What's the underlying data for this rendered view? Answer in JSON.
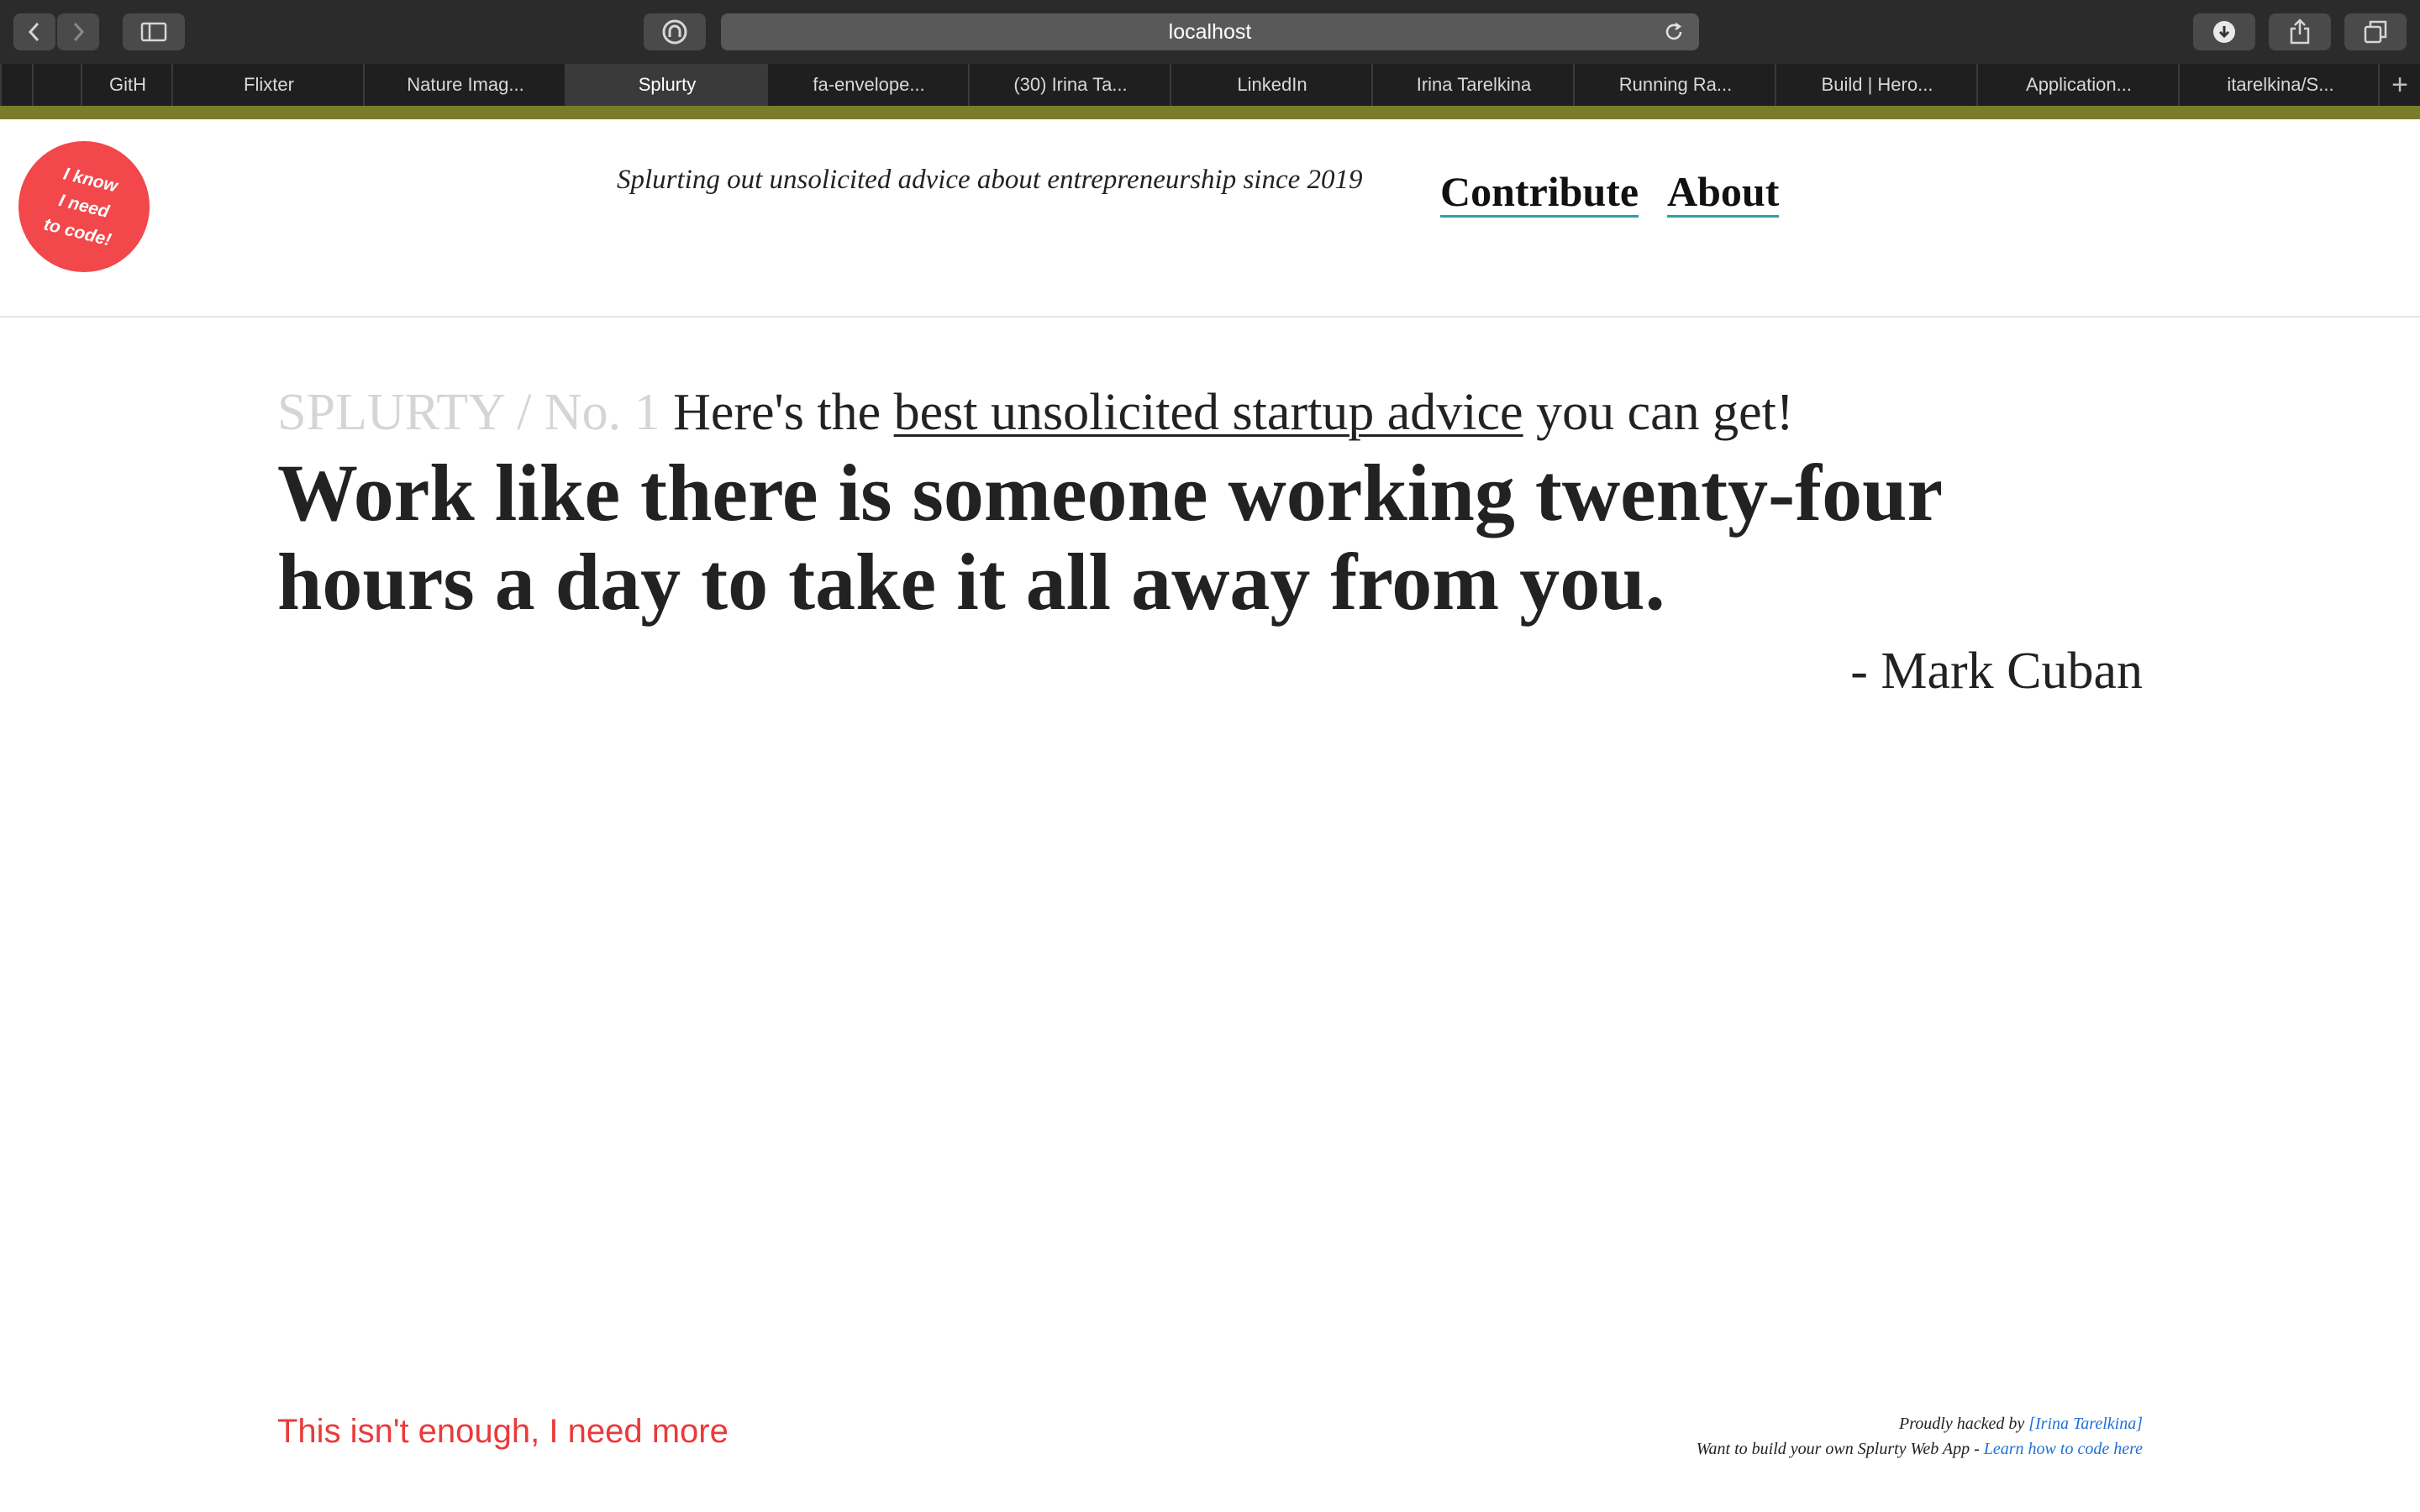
{
  "browser": {
    "url": "localhost",
    "tabs": [
      {
        "label": "",
        "active": false
      },
      {
        "label": "",
        "active": false
      },
      {
        "label": "GitH",
        "active": false
      },
      {
        "label": "Flixter",
        "active": false
      },
      {
        "label": "Nature Imag...",
        "active": false
      },
      {
        "label": "Splurty",
        "active": true
      },
      {
        "label": "fa-envelope...",
        "active": false
      },
      {
        "label": "(30) Irina Ta...",
        "active": false
      },
      {
        "label": "LinkedIn",
        "active": false
      },
      {
        "label": "Irina Tarelkina",
        "active": false
      },
      {
        "label": "Running Ra...",
        "active": false
      },
      {
        "label": "Build | Hero...",
        "active": false
      },
      {
        "label": "Application...",
        "active": false
      },
      {
        "label": "itarelkina/S...",
        "active": false
      }
    ],
    "new_tab": "+",
    "colors": {
      "chrome": "#2b2b2b",
      "accent_bar": "#7b7b2c"
    }
  },
  "header": {
    "badge_text": "I know\nI need\nto code!",
    "badge_color": "#f2474b",
    "tagline": "Splurting out unsolicited advice about entrepreneurship since 2019",
    "nav": {
      "contribute": "Contribute",
      "about": "About"
    },
    "nav_underline_color": "#29a1a8"
  },
  "main": {
    "kicker_muted": "SPLURTY / No. 1",
    "kicker_pre": "Here's the",
    "kicker_link": "best unsolicited startup advice",
    "kicker_post": "you can get!",
    "quote": "Work like there is someone working twenty-four hours a day to take it all away from you.",
    "author": "- Mark Cuban",
    "more_link": "This isn't enough, I need more",
    "more_link_color": "#ea3a3a"
  },
  "footer": {
    "line1_pre": "Proudly hacked by",
    "line1_link": "[Irina Tarelkina]",
    "line2_pre": "Want to build your own Splurty Web App -",
    "line2_link": "Learn how to code here"
  }
}
